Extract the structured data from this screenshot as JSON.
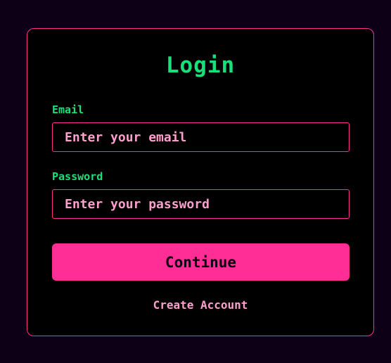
{
  "login_form": {
    "title": "Login",
    "email": {
      "label": "Email",
      "value": "",
      "placeholder": "Enter your email"
    },
    "password": {
      "label": "Password",
      "value": "",
      "placeholder": "Enter your password"
    },
    "continue_label": "Continue",
    "create_account_label": "Create Account"
  },
  "colors": {
    "page_background": "#0d0016",
    "card_background": "#000000",
    "accent_pink": "#ff2e97",
    "label_green": "#18e07a",
    "placeholder_pink": "#ff9fce"
  }
}
